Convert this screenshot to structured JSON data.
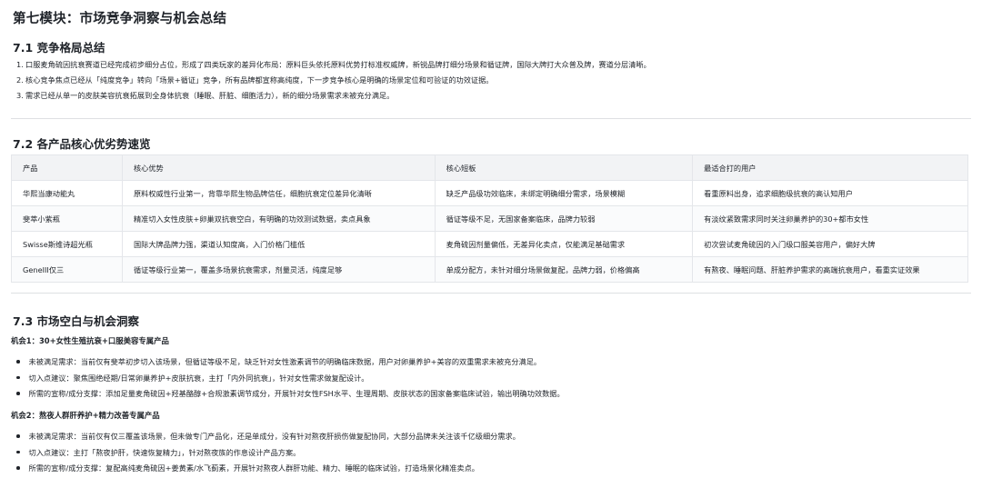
{
  "module_title": "第七模块：市场竞争洞察与机会总结",
  "s71": {
    "title": "7.1 竞争格局总结",
    "items": [
      {
        "num": "1.",
        "text": "口服麦角硫因抗衰赛道已经完成初步细分占位，形成了四类玩家的差异化布局：原料巨头依托原料优势打标准权威牌，新锐品牌打细分场景和循证牌，国际大牌打大众普及牌，赛道分层清晰。"
      },
      {
        "num": "2.",
        "text": "核心竞争焦点已经从「纯度竞争」转向「场景+循证」竞争，所有品牌都宣称高纯度，下一步竞争核心是明确的场景定位和可验证的功效证据。"
      },
      {
        "num": "3.",
        "text": "需求已经从单一的皮肤美容抗衰拓展到全身体抗衰（睡眠、肝脏、细胞活力），新的细分场景需求未被充分满足。"
      }
    ]
  },
  "s72": {
    "title": "7.2 各产品核心优劣势速览",
    "headers": [
      "产品",
      "核心优势",
      "核心短板",
      "最适合打的用户"
    ],
    "rows": [
      [
        "华熙当康动能丸",
        "原料权威性行业第一，背靠华熙生物品牌信任，细胞抗衰定位差异化清晰",
        "缺乏产品级功效临床，未绑定明确细分需求，场景模糊",
        "看重原料出身，追求细胞级抗衰的高认知用户"
      ],
      [
        "斐萃小紫瓶",
        "精准切入女性皮肤+卵巢双抗衰空白，有明确的功效测试数据，卖点具象",
        "循证等级不足，无国家备案临床，品牌力较弱",
        "有淡纹紧致需求同时关注卵巢养护的30+都市女性"
      ],
      [
        "Swisse斯维诗超光瓶",
        "国际大牌品牌力强，渠道认知度高，入门价格门槛低",
        "麦角硫因剂量偏低，无差异化卖点，仅能满足基础需求",
        "初次尝试麦角硫因的入门级口服美容用户，偏好大牌"
      ],
      [
        "GeneIII仅三",
        "循证等级行业第一，覆盖多场景抗衰需求，剂量灵活，纯度足够",
        "单成分配方，未针对细分场景做复配，品牌力弱，价格偏高",
        "有熬夜、睡眠问题、肝脏养护需求的高端抗衰用户，看重实证效果"
      ]
    ]
  },
  "s73": {
    "title": "7.3 市场空白与机会洞察",
    "opportunities": [
      {
        "title": "机会1：30+女性生殖抗衰+口服美容专属产品",
        "bullets": [
          "未被满足需求：当前仅有斐萃初步切入该场景，但循证等级不足，缺乏针对女性激素调节的明确临床数据，用户对卵巢养护+美容的双重需求未被充分满足。",
          "切入点建议：聚焦围绝经期/日常卵巢养护+皮肤抗衰，主打「内外同抗衰」，针对女性需求做复配设计。",
          "所需的宣称/成分支撑：添加足量麦角硫因+羟基酪醇+合规激素调节成分，开展针对女性FSH水平、生理周期、皮肤状态的国家备案临床试验，输出明确功效数据。"
        ]
      },
      {
        "title": "机会2：熬夜人群肝养护+精力改善专属产品",
        "bullets": [
          "未被满足需求：当前仅有仅三覆盖该场景，但未做专门产品化，还是单成分，没有针对熬夜肝损伤做复配协同，大部分品牌未关注该千亿级细分需求。",
          "切入点建议：主打「熬夜护肝，快速恢复精力」，针对熬夜族的作息设计产品方案。",
          "所需的宣称/成分支撑：复配高纯麦角硫因+姜黄素/水飞蓟素，开展针对熬夜人群肝功能、精力、睡眠的临床试验，打造场景化精准卖点。"
        ]
      }
    ]
  }
}
